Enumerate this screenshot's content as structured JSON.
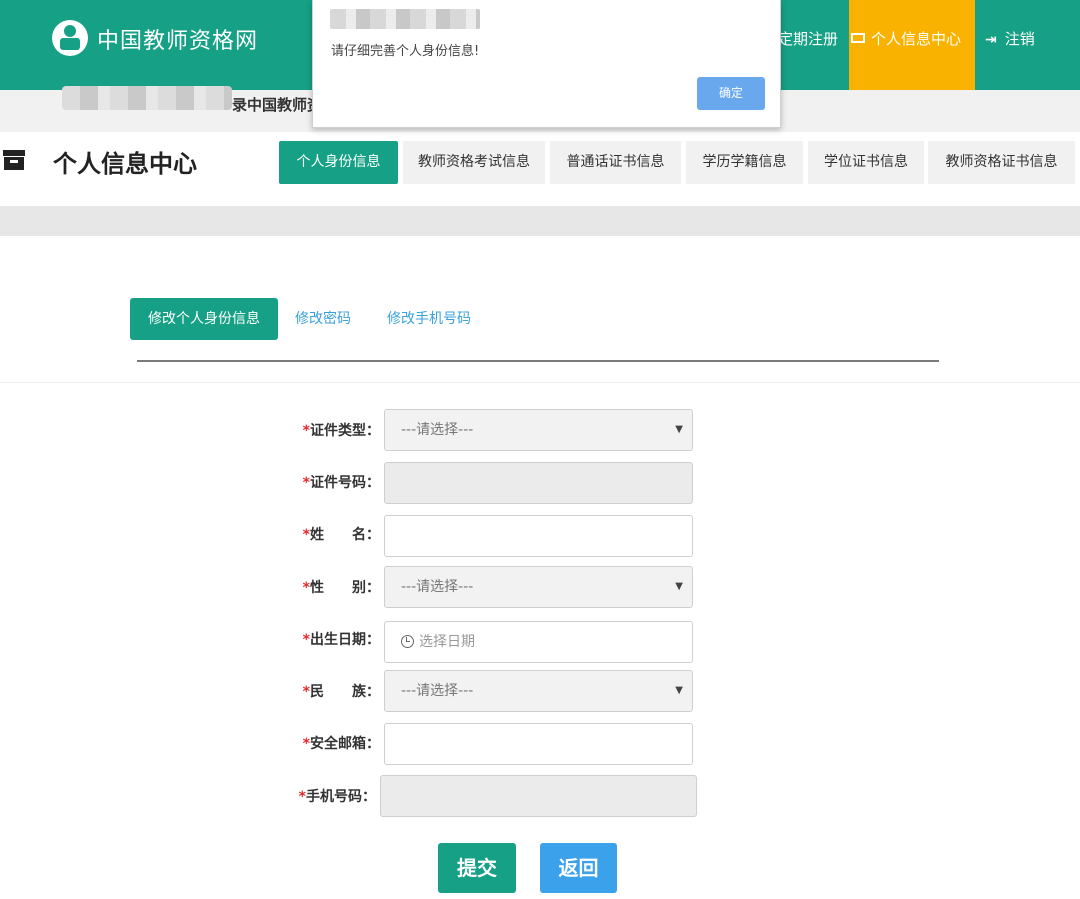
{
  "header": {
    "site_title": "中国教师资格网",
    "nav_register": "定期注册",
    "nav_center": "个人信息中心",
    "nav_logout": "注销",
    "brand_color": "#16a085",
    "highlight_color": "#f9b200"
  },
  "crumb": {
    "text": "录中国教师资"
  },
  "page": {
    "title": "个人信息中心",
    "tabs": [
      {
        "label": "个人身份信息",
        "active": true
      },
      {
        "label": "教师资格考试信息"
      },
      {
        "label": "普通话证书信息"
      },
      {
        "label": "学历学籍信息"
      },
      {
        "label": "学位证书信息"
      },
      {
        "label": "教师资格证书信息"
      }
    ],
    "subtabs": [
      {
        "label": "修改个人身份信息",
        "active": true
      },
      {
        "label": "修改密码"
      },
      {
        "label": "修改手机号码"
      }
    ]
  },
  "form": {
    "required_mark": "*",
    "fields": [
      {
        "label": "证件类型：",
        "type": "select",
        "value": "---请选择---"
      },
      {
        "label": "证件号码：",
        "type": "disabled",
        "value": ""
      },
      {
        "label": "姓　　名：",
        "type": "text",
        "value": ""
      },
      {
        "label": "性　　别：",
        "type": "select",
        "value": "---请选择---"
      },
      {
        "label": "出生日期：",
        "type": "date",
        "placeholder": "选择日期"
      },
      {
        "label": "民　　族：",
        "type": "select",
        "value": "---请选择---"
      },
      {
        "label": "安全邮箱：",
        "type": "text",
        "value": ""
      },
      {
        "label": "手机号码：",
        "type": "disabled",
        "value": ""
      }
    ],
    "arrow_glyph": "▼",
    "submit_label": "提交",
    "back_label": "返回"
  },
  "dialog": {
    "message": "请仔细完善个人身份信息!",
    "ok_label": "确定"
  }
}
